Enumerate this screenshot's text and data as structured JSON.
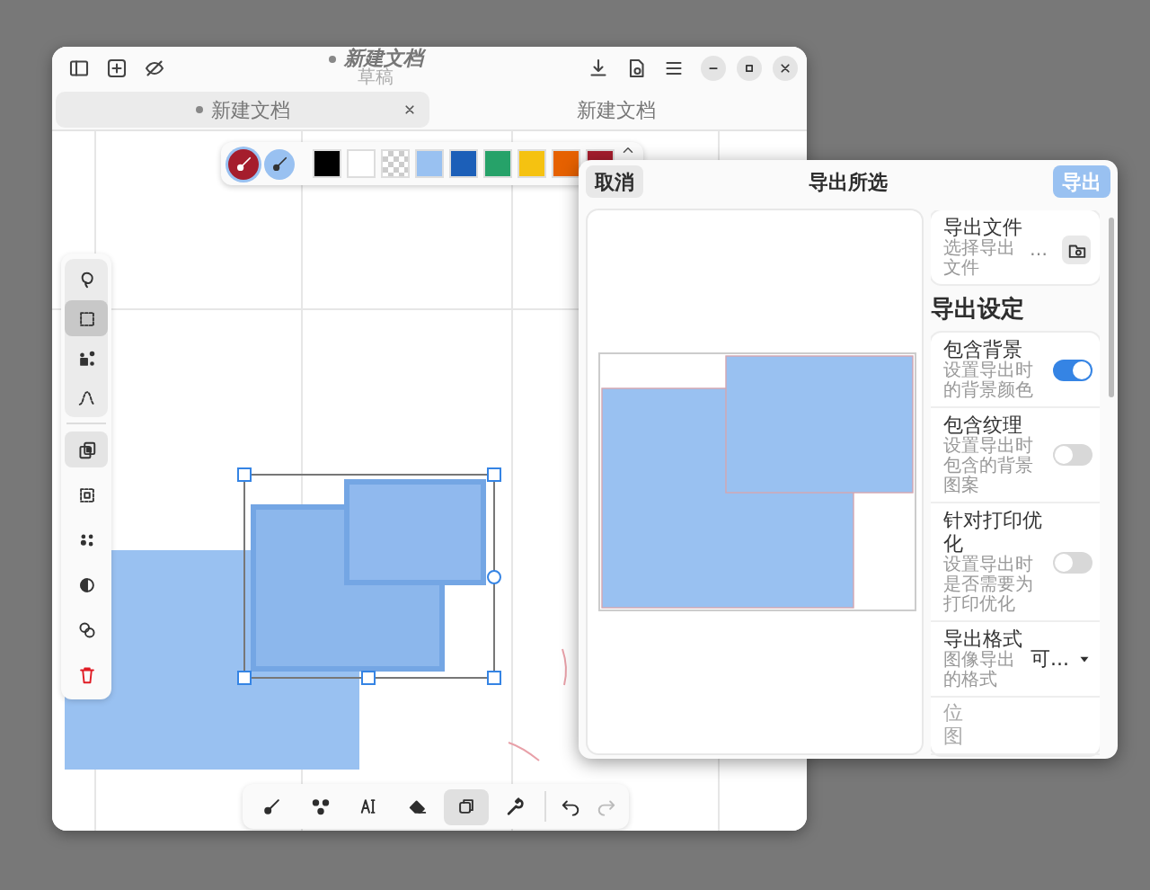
{
  "window": {
    "title": "新建文档",
    "subtitle": "草稿",
    "modified": true
  },
  "tabs": [
    {
      "label": "新建文档",
      "modified": true,
      "selected": true
    },
    {
      "label": "新建文档",
      "modified": false,
      "selected": false
    }
  ],
  "color_bar": {
    "stroke": {
      "color": "#a51d2d"
    },
    "fill": {
      "color": "#99c1f1"
    },
    "swatches": [
      {
        "kind": "solid",
        "color": "#000000"
      },
      {
        "kind": "solid",
        "color": "#ffffff"
      },
      {
        "kind": "transparent"
      },
      {
        "kind": "solid",
        "color": "#99c1f1"
      },
      {
        "kind": "solid",
        "color": "#1c5fb8"
      },
      {
        "kind": "solid",
        "color": "#26a269"
      },
      {
        "kind": "solid",
        "color": "#f5c211"
      },
      {
        "kind": "solid",
        "color": "#e66100"
      },
      {
        "kind": "solid",
        "color": "#a51d2d"
      }
    ]
  },
  "selection_tools": [
    {
      "selected": false
    },
    {
      "selected": true
    },
    {
      "selected": false
    },
    {
      "selected": false
    }
  ],
  "actions": [
    {
      "on": true
    },
    {
      "on": false
    },
    {
      "on": false
    },
    {
      "on": false
    },
    {
      "on": false
    },
    {
      "on": false
    }
  ],
  "bottom_tools": [
    {
      "selected": false
    },
    {
      "selected": false
    },
    {
      "selected": false
    },
    {
      "selected": false
    },
    {
      "selected": true
    },
    {
      "selected": false
    }
  ],
  "history": {
    "undo_disabled": false,
    "redo_disabled": true
  },
  "dialog": {
    "cancel": "取消",
    "title": "导出所选",
    "confirm": "导出",
    "export_file": {
      "title": "导出文件",
      "subtitle": "选择导出文件",
      "value": "…"
    },
    "settings_heading": "导出设定",
    "settings": [
      {
        "kind": "switch",
        "title": "包含背景",
        "subtitle": "设置导出时的背景颜色",
        "on": true
      },
      {
        "kind": "switch",
        "title": "包含纹理",
        "subtitle": "设置导出时包含的背景图案",
        "on": false
      },
      {
        "kind": "switch",
        "title": "针对打印优化",
        "subtitle": "设置导出时是否需要为打印优化",
        "on": false
      },
      {
        "kind": "dropdown",
        "title": "导出格式",
        "subtitle": "图像导出的格式",
        "value": "可..."
      },
      {
        "kind": "note",
        "title": "位图"
      }
    ]
  }
}
